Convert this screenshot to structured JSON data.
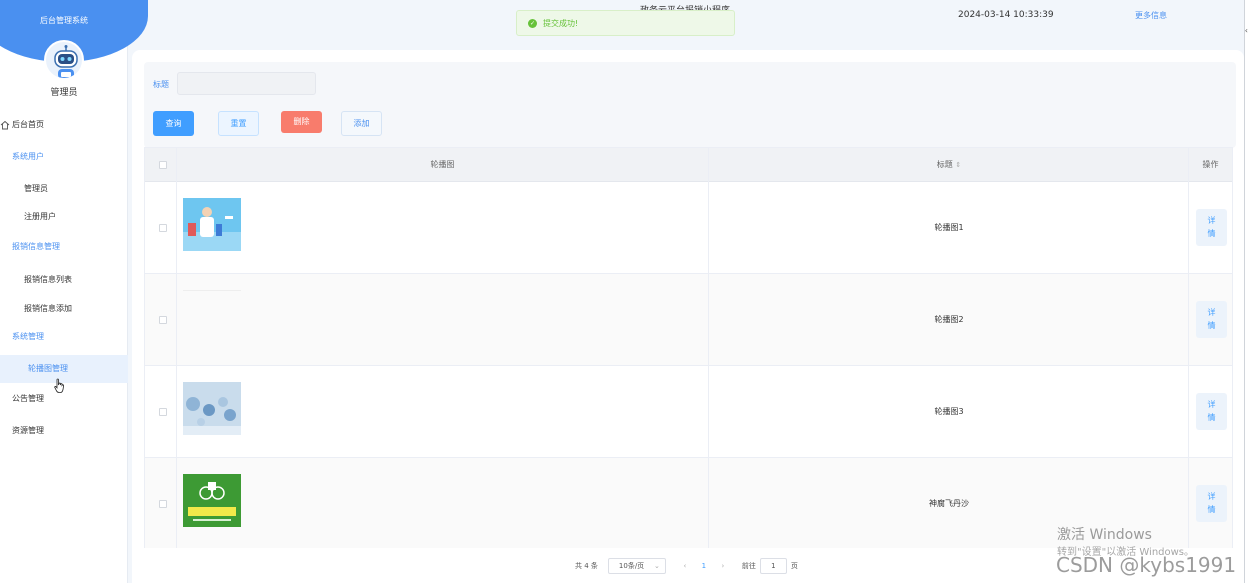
{
  "sidebar": {
    "system_title": "后台管理系统",
    "user_name": "管理员",
    "items": [
      {
        "label": "后台首页",
        "kind": "top",
        "icon": "home-icon"
      },
      {
        "label": "系统用户",
        "kind": "group"
      },
      {
        "label": "管理员",
        "kind": "sub"
      },
      {
        "label": "注册用户",
        "kind": "sub"
      },
      {
        "label": "报销信息管理",
        "kind": "group"
      },
      {
        "label": "报销信息列表",
        "kind": "sub"
      },
      {
        "label": "报销信息添加",
        "kind": "sub"
      },
      {
        "label": "系统管理",
        "kind": "group"
      },
      {
        "label": "轮播图管理",
        "kind": "active"
      },
      {
        "label": "公告管理",
        "kind": "top"
      },
      {
        "label": "资源管理",
        "kind": "top"
      }
    ]
  },
  "header": {
    "title": "政务云平台报销小程序",
    "datetime": "2024-03-14 10:33:39",
    "more_info": "更多信息",
    "menu_icon": "grid-icon"
  },
  "toast": {
    "message": "提交成功!",
    "icon": "check-circle-icon",
    "color": "#67c23a"
  },
  "filter": {
    "title_label": "标题",
    "title_value": "",
    "title_placeholder": ""
  },
  "buttons": {
    "query": "查询",
    "reset": "重置",
    "delete": "删除",
    "add": "添加"
  },
  "table": {
    "columns": {
      "image": "轮播图",
      "title": "标题",
      "actions": "操作"
    },
    "rows": [
      {
        "title": "轮播图1",
        "detail_line1": "详",
        "detail_line2": "情",
        "image": "medical-illustration"
      },
      {
        "title": "轮播图2",
        "detail_line1": "详",
        "detail_line2": "情",
        "image": "blank"
      },
      {
        "title": "轮播图3",
        "detail_line1": "详",
        "detail_line2": "情",
        "image": "blue-molecules"
      },
      {
        "title": "神腐飞丹沙",
        "detail_line1": "详",
        "detail_line2": "情",
        "image": "green-delivery-banner"
      }
    ]
  },
  "pagination": {
    "total": "共 4 条",
    "page_size": "10条/页",
    "current_page": "1",
    "goto_prefix": "前往",
    "goto_value": "1",
    "goto_suffix": "页"
  },
  "watermark": {
    "windows_line1": "激活 Windows",
    "windows_line2": "转到\"设置\"以激活 Windows。",
    "csdn": "CSDN @kybs1991"
  },
  "colors": {
    "primary": "#409eff",
    "sidebar_header": "#4a90f0",
    "danger": "#f87c6c",
    "success": "#67c23a"
  }
}
